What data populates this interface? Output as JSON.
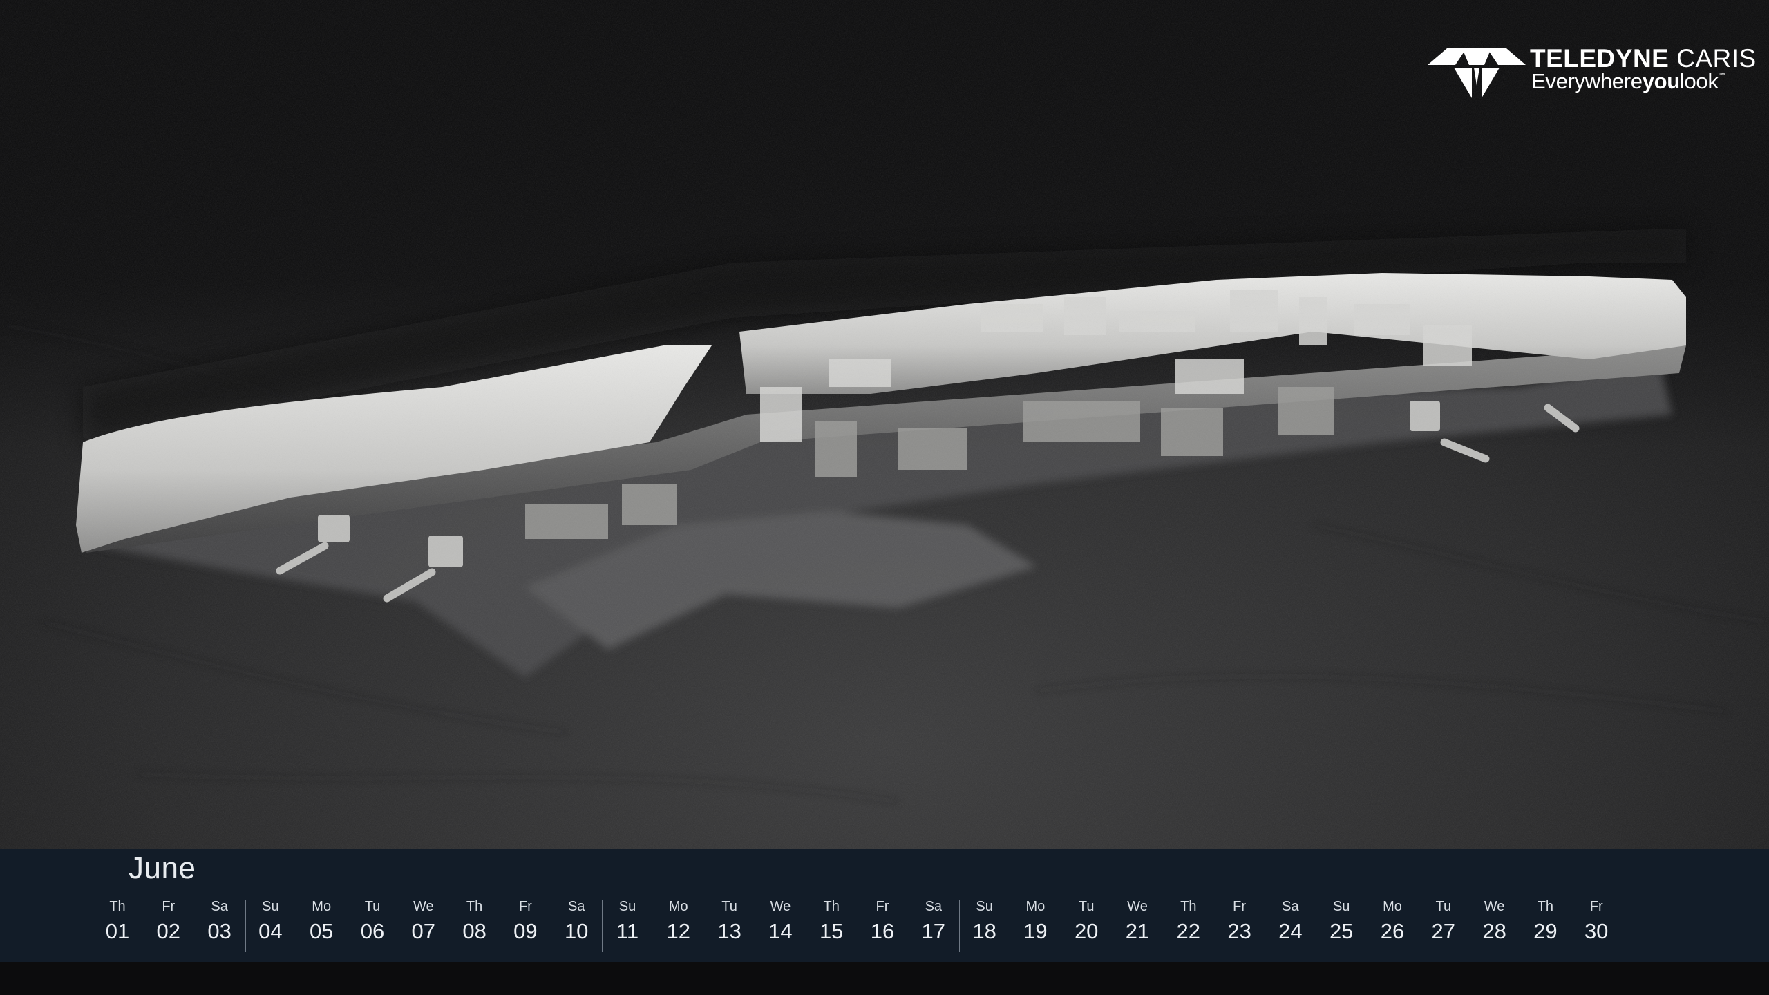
{
  "brand": {
    "name_bold": "TELEDYNE",
    "name_regular": "CARIS",
    "tagline_pre": "Everywhere",
    "tagline_bold": "you",
    "tagline_post": "look",
    "tagline_mark": "™",
    "icon": "teledyne-logo-icon",
    "color": "#ffffff"
  },
  "calendar": {
    "month": "June",
    "background": "#121c28",
    "days": [
      {
        "wd": "Th",
        "d": "01"
      },
      {
        "wd": "Fr",
        "d": "02"
      },
      {
        "wd": "Sa",
        "d": "03"
      },
      {
        "wd": "Su",
        "d": "04"
      },
      {
        "wd": "Mo",
        "d": "05"
      },
      {
        "wd": "Tu",
        "d": "06"
      },
      {
        "wd": "We",
        "d": "07"
      },
      {
        "wd": "Th",
        "d": "08"
      },
      {
        "wd": "Fr",
        "d": "09"
      },
      {
        "wd": "Sa",
        "d": "10"
      },
      {
        "wd": "Su",
        "d": "11"
      },
      {
        "wd": "Mo",
        "d": "12"
      },
      {
        "wd": "Tu",
        "d": "13"
      },
      {
        "wd": "We",
        "d": "14"
      },
      {
        "wd": "Th",
        "d": "15"
      },
      {
        "wd": "Fr",
        "d": "16"
      },
      {
        "wd": "Sa",
        "d": "17"
      },
      {
        "wd": "Su",
        "d": "18"
      },
      {
        "wd": "Mo",
        "d": "19"
      },
      {
        "wd": "Tu",
        "d": "20"
      },
      {
        "wd": "We",
        "d": "21"
      },
      {
        "wd": "Th",
        "d": "22"
      },
      {
        "wd": "Fr",
        "d": "23"
      },
      {
        "wd": "Sa",
        "d": "24"
      },
      {
        "wd": "Su",
        "d": "25"
      },
      {
        "wd": "Mo",
        "d": "26"
      },
      {
        "wd": "Tu",
        "d": "27"
      },
      {
        "wd": "We",
        "d": "28"
      },
      {
        "wd": "Th",
        "d": "29"
      },
      {
        "wd": "Fr",
        "d": "30"
      }
    ]
  }
}
